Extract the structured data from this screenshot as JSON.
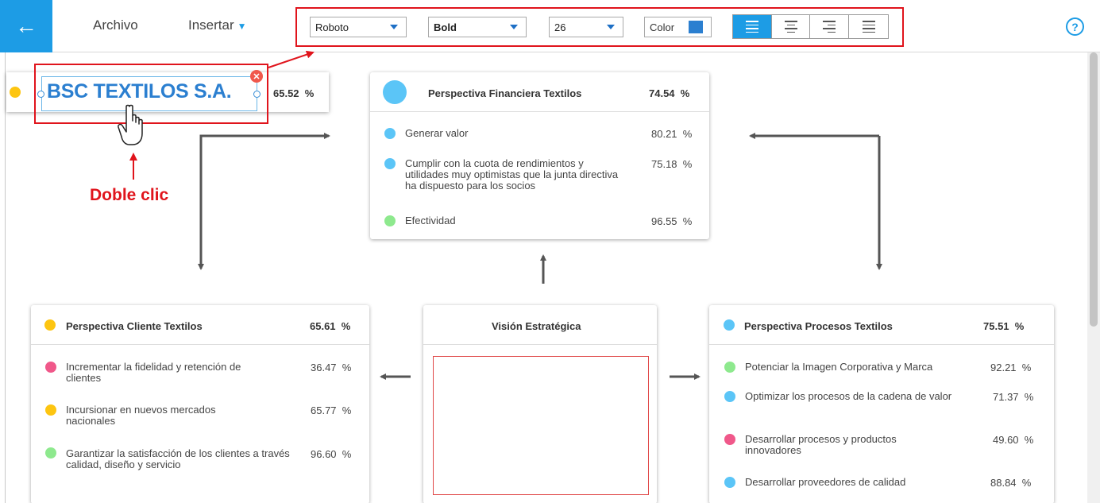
{
  "topbar": {
    "menu": {
      "archivo": "Archivo",
      "insertar": "Insertar"
    },
    "font": "Roboto",
    "weight": "Bold",
    "size": "26",
    "color_label": "Color",
    "color_value": "#2b7fd0",
    "help": "?",
    "back_icon": "←"
  },
  "title_card": {
    "text": "BSC TEXTILOS S.A.",
    "pct": "65.52",
    "unit": "%"
  },
  "annotation": "Doble clic",
  "financiera": {
    "title": "Perspectiva Financiera Textilos",
    "pct": "74.54",
    "unit": "%",
    "items": [
      {
        "text": "Generar valor",
        "val": "80.21",
        "unit": "%",
        "color": "#5bc5f7"
      },
      {
        "text": "Cumplir con la cuota de rendimientos y utilidades muy optimistas que la junta directiva ha dispuesto para los socios",
        "val": "75.18",
        "unit": "%",
        "color": "#5bc5f7"
      },
      {
        "text": "Efectividad",
        "val": "96.55",
        "unit": "%",
        "color": "#8ee98e"
      }
    ]
  },
  "cliente": {
    "title": "Perspectiva Cliente Textilos",
    "pct": "65.61",
    "unit": "%",
    "items": [
      {
        "text": "Incrementar la fidelidad y retención de clientes",
        "val": "36.47",
        "unit": "%",
        "color": "#f0588a"
      },
      {
        "text": "Incursionar en nuevos mercados nacionales",
        "val": "65.77",
        "unit": "%",
        "color": "#fdc511"
      },
      {
        "text": "Garantizar la satisfacción de los clientes a través calidad, diseño y servicio",
        "val": "96.60",
        "unit": "%",
        "color": "#8ee98e"
      }
    ]
  },
  "vision": {
    "title": "Visión Estratégica"
  },
  "procesos": {
    "title": "Perspectiva Procesos Textilos",
    "pct": "75.51",
    "unit": "%",
    "items": [
      {
        "text": "Potenciar la Imagen Corporativa y Marca",
        "val": "92.21",
        "unit": "%",
        "color": "#8ee98e"
      },
      {
        "text": "Optimizar los procesos de la cadena de valor",
        "val": "71.37",
        "unit": "%",
        "color": "#5bc5f7"
      },
      {
        "text": "Desarrollar procesos y productos innovadores",
        "val": "49.60",
        "unit": "%",
        "color": "#f0588a"
      },
      {
        "text": "Desarrollar proveedores de calidad",
        "val": "88.84",
        "unit": "%",
        "color": "#5bc5f7"
      }
    ]
  }
}
